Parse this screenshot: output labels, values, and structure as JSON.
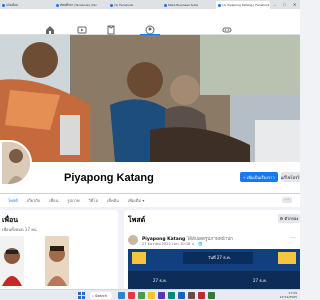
{
  "browser": {
    "tabs": [
      {
        "title": "แจ้งเตือน"
      },
      {
        "title": "ทัศนศึกษา (facebook) (fac"
      },
      {
        "title": "(1) Facebook"
      },
      {
        "title": "Meta Business Suite"
      },
      {
        "title": "(1) Piyapong Katang | Facebook",
        "active": true
      }
    ]
  },
  "nav": {
    "icons": [
      "home-icon",
      "video-icon",
      "marketplace-icon",
      "groups-icon",
      "gaming-icon"
    ]
  },
  "profile": {
    "name": "Piyapong Katang",
    "add_story_label": "+ เพิ่มเป็นเรื่องราว",
    "edit_label": "✎ แก้ไขโปรไฟล์"
  },
  "profile_tabs": [
    {
      "label": "โพสต์",
      "active": true
    },
    {
      "label": "เกี่ยวกับ"
    },
    {
      "label": "เพื่อน"
    },
    {
      "label": "รูปภาพ"
    },
    {
      "label": "วิดีโอ"
    },
    {
      "label": "เช็คอิน"
    },
    {
      "label": "เพิ่มเติม ▾"
    }
  ],
  "friends_card": {
    "title": "เพื่อน",
    "count": "เพื่อนทั้งหมด 17 คน"
  },
  "posts_card": {
    "title": "โพสต์",
    "filter_label": "⚙ ตัวกรอง"
  },
  "post": {
    "author": "Piyapong Katang",
    "action": "ได้อัปเดตรูปภาพหน้าปก",
    "time": "27 ธันวาคม 2022 เวลา 10:18 น. · 🌐",
    "media_lines": [
      "วันที่ 27 ธ.ค.",
      "27 ธ.ค.",
      "27 ธ.ค."
    ]
  },
  "taskbar": {
    "search_label": "Search",
    "time": "17:29",
    "date": "27/12/2565"
  }
}
